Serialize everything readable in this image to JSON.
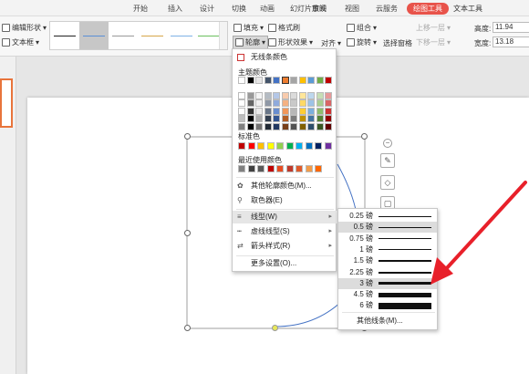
{
  "tabs": [
    "开始",
    "插入",
    "设计",
    "切换",
    "动画",
    "幻灯片放映",
    "审阅",
    "视图",
    "云服务",
    "绘图工具",
    "文本工具"
  ],
  "ribbon": {
    "edit_shape": "编辑形状",
    "text_box": "文本框",
    "fill": "填充",
    "format_brush": "格式刷",
    "outline": "轮廓",
    "shape_effect": "形状效果",
    "align": "对齐",
    "group": "组合",
    "rotate": "旋转",
    "select_pane": "选择窗格",
    "bring_forward": "上移一层",
    "send_backward": "下移一层",
    "height_label": "高度:",
    "height_value": "11.94",
    "width_label": "宽度:",
    "width_value": "13.18"
  },
  "menu": {
    "no_outline": "无线条颜色",
    "theme_colors": "主题颜色",
    "standard_colors": "标准色",
    "recent_colors": "最近使用颜色",
    "other_colors": "其他轮廓颜色(M)...",
    "eyedropper": "取色器(E)",
    "line_type": "线型(W)",
    "dash_type": "虚线线型(S)",
    "arrow_style": "箭头样式(R)",
    "more_settings": "更多设置(O)...",
    "theme_row": [
      "#ffffff",
      "#000000",
      "#e7e6e6",
      "#44546a",
      "#4472c4",
      "#ed7d31",
      "#a5a5a5",
      "#ffc000",
      "#5b9bd5",
      "#70ad47",
      "#c00000"
    ],
    "standard_row": [
      "#c00000",
      "#ff0000",
      "#ffc000",
      "#ffff00",
      "#92d050",
      "#00b050",
      "#00b0f0",
      "#0070c0",
      "#002060",
      "#7030a0"
    ],
    "recent_row": [
      "#808080",
      "#404040",
      "#595959",
      "#c00000",
      "#e84c22",
      "#c0392b",
      "#e05a2b",
      "#f39c4a",
      "#ff6600"
    ]
  },
  "submenu": {
    "widths": [
      {
        "label": "0.25 磅",
        "w": 0.25
      },
      {
        "label": "0.5 磅",
        "w": 0.5
      },
      {
        "label": "0.75 磅",
        "w": 0.75
      },
      {
        "label": "1 磅",
        "w": 1
      },
      {
        "label": "1.5 磅",
        "w": 1.5
      },
      {
        "label": "2.25 磅",
        "w": 2.25
      },
      {
        "label": "3 磅",
        "w": 3
      },
      {
        "label": "4.5 磅",
        "w": 4.5
      },
      {
        "label": "6 磅",
        "w": 6
      }
    ],
    "highlighted": [
      "0.5 磅",
      "3 磅"
    ],
    "other_lines": "其他线条(M)..."
  },
  "colors": {
    "accent": "#e8534a",
    "arrow": "#e8202a",
    "shape_line": "#4472c4"
  }
}
